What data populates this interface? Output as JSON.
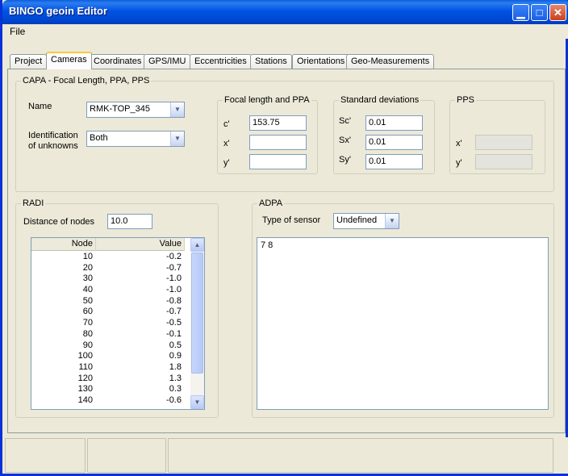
{
  "window": {
    "title": "BINGO geoin Editor"
  },
  "menu": {
    "file": "File"
  },
  "tabs": [
    "Project",
    "Cameras",
    "Coordinates",
    "GPS/IMU",
    "Eccentricities",
    "Stations",
    "Orientations",
    "Geo-Measurements"
  ],
  "capa": {
    "legend": "CAPA - Focal Length, PPA, PPS",
    "name_label": "Name",
    "name_value": "RMK-TOP_345",
    "ident_label_1": "Identification",
    "ident_label_2": "of unknowns",
    "ident_value": "Both",
    "focal": {
      "legend": "Focal length and PPA",
      "c_label": "c'",
      "c_value": "153.75",
      "x_label": "x'",
      "x_value": "",
      "y_label": "y'",
      "y_value": ""
    },
    "std": {
      "legend": "Standard deviations",
      "sc_label": "Sc'",
      "sc_value": "0.01",
      "sx_label": "Sx'",
      "sx_value": "0.01",
      "sy_label": "Sy'",
      "sy_value": "0.01"
    },
    "pps": {
      "legend": "PPS",
      "x_label": "x'",
      "x_value": "",
      "y_label": "y'",
      "y_value": ""
    }
  },
  "radi": {
    "legend": "RADI",
    "distance_label": "Distance of nodes",
    "distance_value": "10.0",
    "columns": [
      "Node",
      "Value"
    ],
    "rows": [
      [
        "10",
        "-0.2"
      ],
      [
        "20",
        "-0.7"
      ],
      [
        "30",
        "-1.0"
      ],
      [
        "40",
        "-1.0"
      ],
      [
        "50",
        "-0.8"
      ],
      [
        "60",
        "-0.7"
      ],
      [
        "70",
        "-0.5"
      ],
      [
        "80",
        "-0.1"
      ],
      [
        "90",
        "0.5"
      ],
      [
        "100",
        "0.9"
      ],
      [
        "110",
        "1.8"
      ],
      [
        "120",
        "1.3"
      ],
      [
        "130",
        "0.3"
      ],
      [
        "140",
        "-0.6"
      ]
    ]
  },
  "adpa": {
    "legend": "ADPA",
    "sensor_label": "Type of sensor",
    "sensor_value": "Undefined",
    "text": "7   8"
  },
  "colors": {
    "titlebar": "#0054E3",
    "window_bg": "#ECE9D8",
    "active_tab_accent": "#FFC83C"
  },
  "icons": {
    "minimize": "minimize-icon",
    "maximize": "maximize-icon",
    "close": "close-icon",
    "dropdown": "chevron-down-icon",
    "scroll_up": "scroll-up-icon",
    "scroll_down": "scroll-down-icon"
  }
}
